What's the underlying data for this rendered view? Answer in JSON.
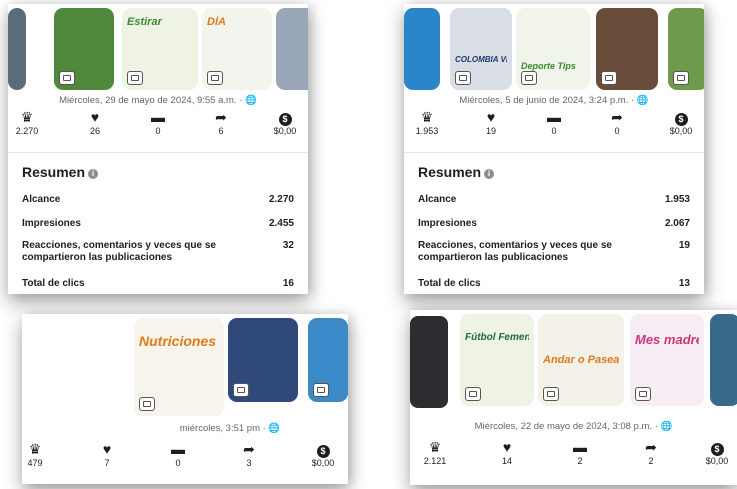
{
  "panels": [
    {
      "thumbnails": [
        {
          "title": "",
          "bg": "#5a6b7a"
        },
        {
          "title": "",
          "bg": "#4f8a3c"
        },
        {
          "title": "Estirar",
          "bg": "#eef3e6",
          "fg": "#3a8a2c"
        },
        {
          "title": "DÍA",
          "bg": "#f4f4ef",
          "fg": "#e07a1b"
        },
        {
          "title": "",
          "bg": "#9aa7b8"
        }
      ],
      "date": "Miércoles, 29 de mayo de 2024, 9:55 a.m. · 🌐",
      "stats": [
        "2.270",
        "26",
        "0",
        "6",
        "$0,00"
      ],
      "summary_title": "Resumen",
      "rows": [
        {
          "label": "Alcance",
          "value": "2.270"
        },
        {
          "label": "Impresiones",
          "value": "2.455"
        },
        {
          "label": "Reacciones, comentarios y veces que se",
          "label2": "compartieron las publicaciones",
          "value": "32"
        },
        {
          "label": "Total de clics",
          "value": "16"
        }
      ]
    },
    {
      "thumbnails": [
        {
          "title": "",
          "bg": "#2a86c8"
        },
        {
          "title": "COLOMBIA VIDA",
          "bg": "#d9dde6",
          "fg": "#1d3a6e"
        },
        {
          "title": "Deporte Tips",
          "bg": "#f1f4ea",
          "fg": "#3a8a2c"
        },
        {
          "title": "",
          "bg": "#6a4c3a"
        },
        {
          "title": "",
          "bg": "#6f9a4c"
        }
      ],
      "date": "Miércoles, 5 de junio de 2024, 3:24 p.m. · 🌐",
      "stats": [
        "1.953",
        "19",
        "0",
        "0",
        "$0,00"
      ],
      "summary_title": "Resumen",
      "rows": [
        {
          "label": "Alcance",
          "value": "1.953"
        },
        {
          "label": "Impresiones",
          "value": "2.067"
        },
        {
          "label": "Reacciones, comentarios y veces que se",
          "label2": "compartieron las publicaciones",
          "value": "19"
        },
        {
          "label": "Total de clics",
          "value": "13"
        }
      ]
    },
    {
      "thumbnails": [
        {
          "title": "Nutriciones",
          "bg": "#f6f4ec",
          "fg": "#e07a1b"
        },
        {
          "title": "",
          "bg": "#2f4a7a"
        },
        {
          "title": "",
          "bg": "#3a8ac8"
        }
      ],
      "date": "miércoles, 3:51 pm · 🌐",
      "stats": [
        "479",
        "7",
        "0",
        "3",
        "$0,00"
      ]
    },
    {
      "thumbnails": [
        {
          "title": "Fútbol Femenino",
          "bg": "#eef3e6",
          "fg": "#1d6a3a"
        },
        {
          "title": "Andar o Pasear",
          "bg": "#f4f1e8",
          "fg": "#e07a1b"
        },
        {
          "title": "Mes madre",
          "bg": "#f6eef4",
          "fg": "#d6337a"
        },
        {
          "title": "",
          "bg": "#3a6a8a"
        }
      ],
      "date": "Miércoles, 22 de mayo de 2024, 3:08 p.m. · 🌐",
      "stats": [
        "2.121",
        "14",
        "2",
        "2",
        "$0,00"
      ]
    }
  ],
  "stat_icons": [
    "reach-icon",
    "reactions-icon",
    "comment-icon",
    "share-icon",
    "dollar-icon"
  ],
  "colors": {
    "accent_green": "#3a8a2c",
    "text": "#1c1e21",
    "muted": "#606770"
  }
}
